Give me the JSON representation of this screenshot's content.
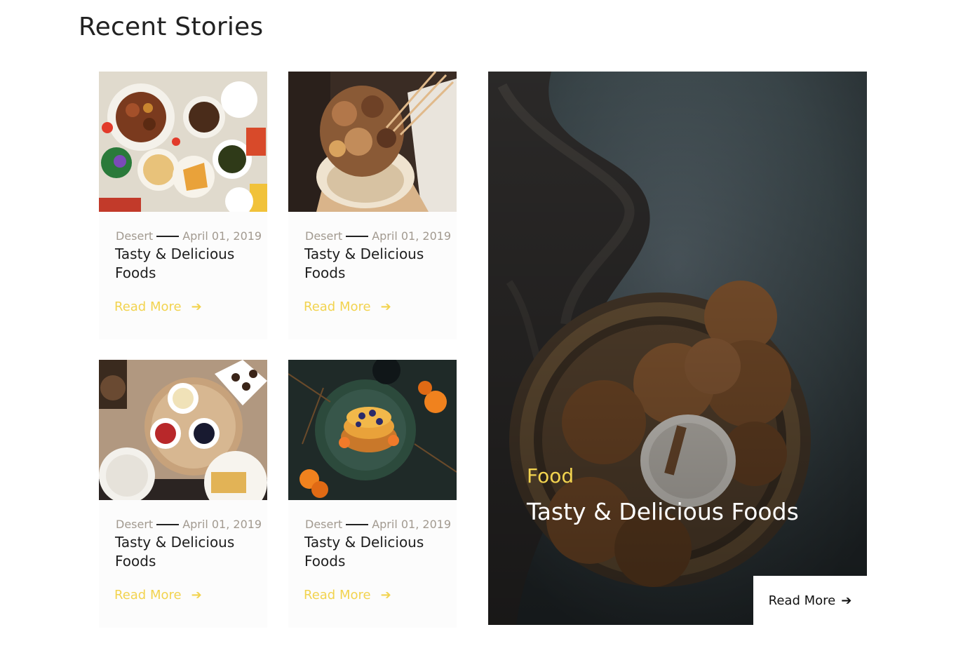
{
  "section": {
    "title": "Recent Stories"
  },
  "cards": [
    {
      "category": "Desert",
      "date": "April 01, 2019",
      "title": "Tasty & Delicious Foods",
      "read_more": "Read More",
      "image": "food-spread-photo"
    },
    {
      "category": "Desert",
      "date": "April 01, 2019",
      "title": "Tasty & Delicious Foods",
      "read_more": "Read More",
      "image": "meat-skewers-photo"
    },
    {
      "category": "Desert",
      "date": "April 01, 2019",
      "title": "Tasty & Delicious Foods",
      "read_more": "Read More",
      "image": "breakfast-table-photo"
    },
    {
      "category": "Desert",
      "date": "April 01, 2019",
      "title": "Tasty & Delicious Foods",
      "read_more": "Read More",
      "image": "pancakes-photo"
    }
  ],
  "feature": {
    "category": "Food",
    "title": "Tasty & Delicious Foods",
    "read_more": "Read More",
    "image": "cookies-basket-photo"
  },
  "colors": {
    "accent": "#f2d34f",
    "meta_text": "#a29a90",
    "title_text": "#1e1e1e"
  },
  "icons": {
    "arrow": "arrow-right-icon"
  }
}
